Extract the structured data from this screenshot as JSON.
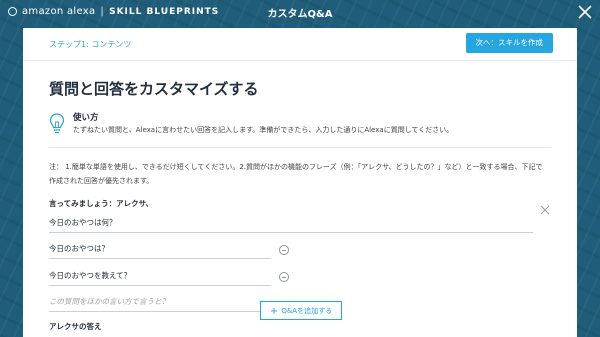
{
  "header": {
    "brand": "amazon alexa",
    "separator": "|",
    "product": "SKILL BLUEPRINTS",
    "title": "カスタムQ&A",
    "close_icon": "close-icon"
  },
  "panel": {
    "step_label": "ステップ1: コンテンツ",
    "next_button": "次へ：スキルを作成",
    "heading": "質問と回答をカスタマイズする",
    "tip": {
      "icon": "lightbulb-icon",
      "title": "使い方",
      "description": "たずねたい質問と、Alexaに言わせたい回答を記入します。準備ができたら、入力した通りにAlexaに質問してください。"
    },
    "note": "注： 1.簡単な単語を使用し、できるだけ短くしてください。2.質問がほかの機能のフレーズ（例：「アレクサ、どうしたの？」など）と一致する場合、下記で作成された回答が優先されます。",
    "say_label": "言ってみましょう：アレクサ、",
    "questions": [
      "今日のおやつは何？",
      "今日のおやつは？",
      "今日のおやつを教えて？"
    ],
    "placeholder": "この質問をほかの言い方で言うと？",
    "add_button": "Q&Aを追加する",
    "answer_label": "アレクサの答え"
  },
  "colors": {
    "accent": "#26a6e0",
    "background": "#1f5d7a",
    "text": "#232f3e"
  }
}
